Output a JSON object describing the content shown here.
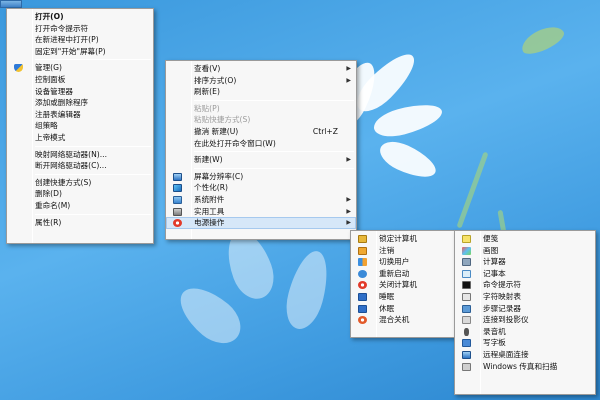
{
  "main_menu": {
    "items": [
      {
        "label": "打开(O)",
        "bold": true
      },
      {
        "label": "打开命令提示符"
      },
      {
        "label": "在新进程中打开(P)"
      },
      {
        "label": "固定到\"开始\"屏幕(P)"
      },
      {
        "label": "管理(G)",
        "icon": "shield-icon"
      },
      {
        "label": "控制面板"
      },
      {
        "label": "设备管理器"
      },
      {
        "label": "添加或删除程序"
      },
      {
        "label": "注册表编辑器"
      },
      {
        "label": "组策略"
      },
      {
        "label": "上帝模式"
      },
      {
        "label": "映射网络驱动器(N)..."
      },
      {
        "label": "断开网络驱动器(C)..."
      },
      {
        "label": "创建快捷方式(S)"
      },
      {
        "label": "删除(D)"
      },
      {
        "label": "重命名(M)"
      },
      {
        "label": "属性(R)"
      }
    ]
  },
  "desktop_menu": {
    "items": [
      {
        "label": "查看(V)",
        "submenu": true
      },
      {
        "label": "排序方式(O)",
        "submenu": true
      },
      {
        "label": "刷新(E)"
      },
      {
        "label": "粘贴(P)",
        "disabled": true
      },
      {
        "label": "粘贴快捷方式(S)",
        "disabled": true
      },
      {
        "label": "撤消 新建(U)",
        "shortcut": "Ctrl+Z"
      },
      {
        "label": "在此处打开命令窗口(W)"
      },
      {
        "label": "新建(W)",
        "submenu": true
      },
      {
        "label": "屏幕分辨率(C)",
        "icon": "display-icon"
      },
      {
        "label": "个性化(R)",
        "icon": "personalize-icon"
      },
      {
        "label": "系统附件",
        "icon": "accessories-icon",
        "submenu": true
      },
      {
        "label": "实用工具",
        "icon": "tools-icon",
        "submenu": true
      },
      {
        "label": "电源操作",
        "icon": "power-icon",
        "submenu": true,
        "highlighted": true
      }
    ]
  },
  "power_menu": {
    "items": [
      {
        "label": "锁定计算机",
        "icon": "lock-icon"
      },
      {
        "label": "注销",
        "icon": "logoff-icon"
      },
      {
        "label": "切换用户",
        "icon": "switch-user-icon"
      },
      {
        "label": "重新启动",
        "icon": "restart-icon"
      },
      {
        "label": "关闭计算机",
        "icon": "shutdown-icon"
      },
      {
        "label": "睡眠",
        "icon": "sleep-icon"
      },
      {
        "label": "休眠",
        "icon": "hibernate-icon"
      },
      {
        "label": "混合关机",
        "icon": "hybrid-shutdown-icon"
      }
    ]
  },
  "tools_menu": {
    "items": [
      {
        "label": "便笺",
        "icon": "sticky-notes-icon"
      },
      {
        "label": "画图",
        "icon": "paint-icon"
      },
      {
        "label": "计算器",
        "icon": "calculator-icon"
      },
      {
        "label": "记事本",
        "icon": "notepad-icon"
      },
      {
        "label": "命令提示符",
        "icon": "cmd-icon"
      },
      {
        "label": "字符映射表",
        "icon": "charmap-icon"
      },
      {
        "label": "步骤记录器",
        "icon": "steps-recorder-icon"
      },
      {
        "label": "连接到投影仪",
        "icon": "projector-icon"
      },
      {
        "label": "录音机",
        "icon": "sound-recorder-icon"
      },
      {
        "label": "写字板",
        "icon": "wordpad-icon"
      },
      {
        "label": "远程桌面连接",
        "icon": "remote-desktop-icon"
      },
      {
        "label": "Windows 传真和扫描",
        "icon": "fax-scan-icon"
      }
    ]
  },
  "colors": {
    "highlight": "#d6e7f8",
    "menu_bg": "#f7f7f7",
    "desktop": "#4aa6e6"
  }
}
